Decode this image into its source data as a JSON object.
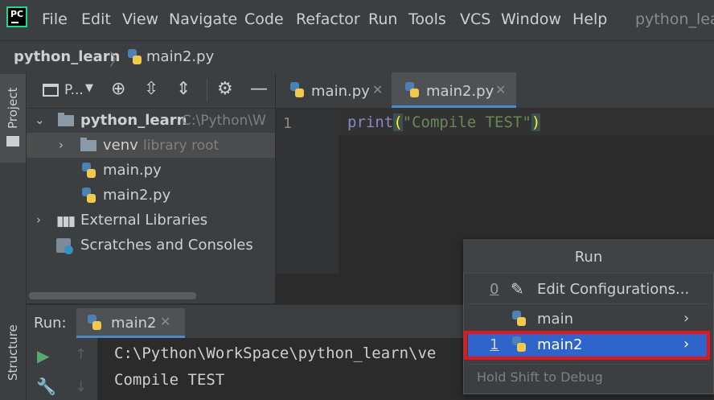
{
  "app": {
    "logo_text": "PC",
    "window_title": "python_lear"
  },
  "menu": [
    "File",
    "Edit",
    "View",
    "Navigate",
    "Code",
    "Refactor",
    "Run",
    "Tools",
    "VCS",
    "Window",
    "Help"
  ],
  "breadcrumb": {
    "project": "python_learn",
    "file": "main2.py"
  },
  "side_tabs": {
    "project": "Project",
    "structure": "Structure"
  },
  "project_panel": {
    "view_selector": "P...",
    "tree": [
      {
        "label": "python_learn",
        "hint": "C:\\Python\\W"
      },
      {
        "label": "venv",
        "hint": "library root"
      },
      {
        "label": "main.py"
      },
      {
        "label": "main2.py"
      },
      {
        "label": "External Libraries"
      },
      {
        "label": "Scratches and Consoles"
      }
    ]
  },
  "editor": {
    "tabs": [
      {
        "label": "main.py"
      },
      {
        "label": "main2.py",
        "active": true
      }
    ],
    "line_number": "1",
    "code": {
      "func": "print",
      "open": "(",
      "string": "\"Compile TEST\"",
      "close": ")"
    }
  },
  "run_panel": {
    "title": "Run:",
    "tab_label": "main2",
    "output": [
      "C:\\Python\\WorkSpace\\python_learn\\ve",
      "Compile TEST"
    ]
  },
  "run_popup": {
    "title": "Run",
    "items": [
      {
        "number": "0",
        "label": "Edit Configurations...",
        "icon": "pencil-icon"
      },
      {
        "number": "",
        "label": "main",
        "icon": "python-icon"
      },
      {
        "number": "1",
        "label": "main2",
        "icon": "python-icon",
        "selected": true
      }
    ],
    "footer": "Hold Shift to Debug"
  },
  "colors": {
    "accent": "#2f65ca",
    "highlight": "#e8141c"
  }
}
